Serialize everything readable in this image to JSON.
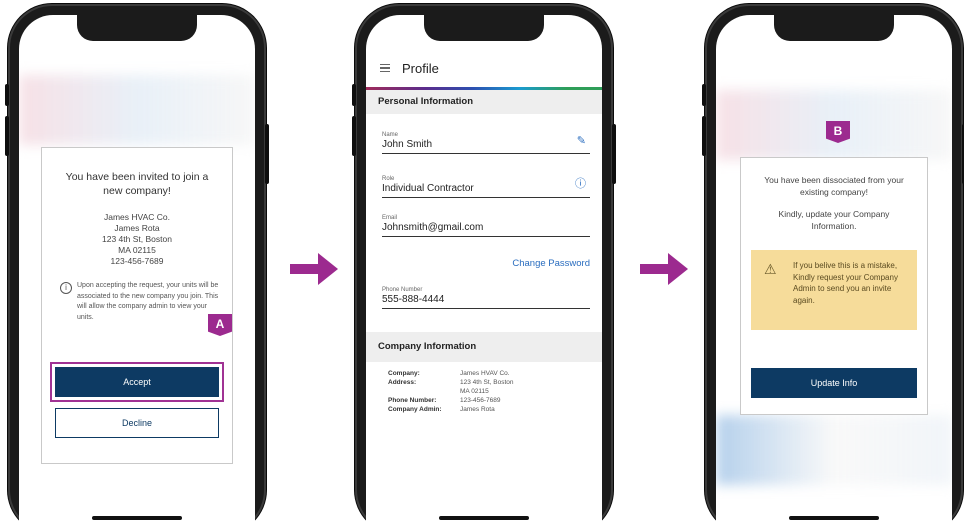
{
  "colors": {
    "accent": "#0d3a63",
    "highlight": "#9c2a8f",
    "link": "#2a6dbf",
    "warning_bg": "#f6dc9a"
  },
  "screen1": {
    "badge": "A",
    "invite_title": "You have been invited to join a new company!",
    "address_lines": [
      "James HVAC Co.",
      "James Rota",
      "123 4th St, Boston",
      "MA 02115",
      "123-456-7689"
    ],
    "notice_icon": "info-icon",
    "notice": "Upon accepting the request, your units will be associated to the new company you join. This will allow the company admin to view your units.",
    "accept_label": "Accept",
    "decline_label": "Decline"
  },
  "screen2": {
    "title": "Profile",
    "personal_header": "Personal Information",
    "fields": [
      {
        "label": "Name",
        "value": "John Smith",
        "icon": "pencil-icon"
      },
      {
        "label": "Role",
        "value": "Individual Contractor",
        "icon": "info-icon"
      },
      {
        "label": "Email",
        "value": "Johnsmith@gmail.com"
      },
      {
        "label": "Phone Number",
        "value": "555-888-4444"
      }
    ],
    "change_password": "Change Password",
    "company_header": "Company Information",
    "company": {
      "company_label": "Company:",
      "company_value": "James HVAV Co.",
      "address_label": "Address:",
      "address_line1": "123 4th St, Boston",
      "address_line2": "MA 02115",
      "phone_label": "Phone Number:",
      "phone_value": "123-456-7689",
      "admin_label": "Company Admin:",
      "admin_value": "James Rota"
    }
  },
  "screen3": {
    "badge": "B",
    "message1": "You have been dissociated from your existing company!",
    "message2": "Kindly, update your Company Information.",
    "warning_icon": "warning-icon",
    "warning": "If you belive this is a mistake, Kindly request your Company Admin to send you an invite again.",
    "update_label": "Update Info"
  }
}
